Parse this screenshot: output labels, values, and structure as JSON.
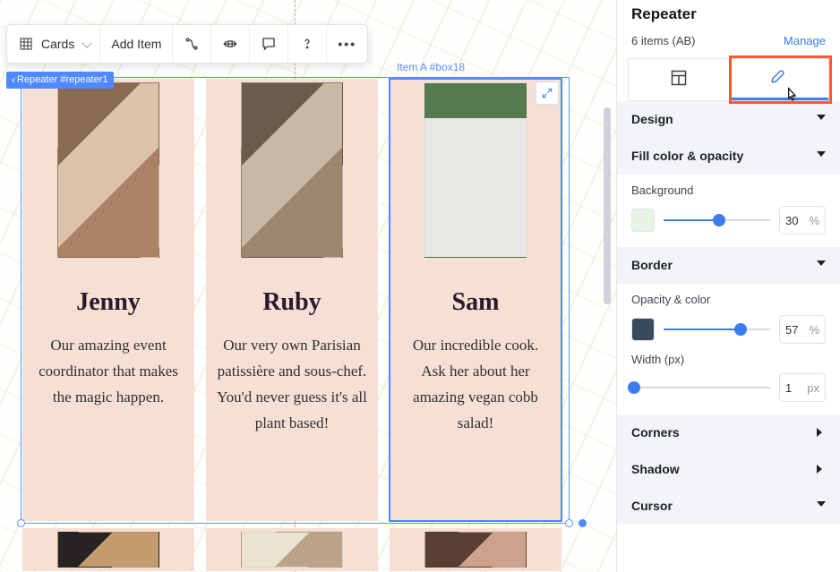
{
  "toolbar": {
    "preset_label": "Cards",
    "add_item": "Add Item"
  },
  "badge": {
    "label": "Repeater #repeater1"
  },
  "item_hint": "Item A #box18",
  "cards": [
    {
      "name": "Jenny",
      "desc": "Our amazing event coordinator that makes the magic happen."
    },
    {
      "name": "Ruby",
      "desc": "Our very own Parisian patissière and sous-chef. You'd never guess it's all plant based!"
    },
    {
      "name": "Sam",
      "desc": "Our incredible cook. Ask her about her amazing vegan cobb salad!"
    }
  ],
  "inspector": {
    "title": "Repeater",
    "items_label": "6 items (AB)",
    "manage": "Manage",
    "sections": {
      "design": "Design",
      "fill": "Fill color & opacity",
      "border": "Border",
      "corners": "Corners",
      "shadow": "Shadow",
      "cursor": "Cursor"
    },
    "fill": {
      "background_label": "Background",
      "value": "30",
      "unit": "%",
      "swatch": "#e6f3e6",
      "slider_pct": 52
    },
    "border": {
      "opacity_label": "Opacity & color",
      "opacity_value": "57",
      "opacity_unit": "%",
      "opacity_swatch": "#3b4a5c",
      "opacity_slider_pct": 72,
      "width_label": "Width (px)",
      "width_value": "1",
      "width_unit": "px",
      "width_slider_pct": 2
    }
  }
}
